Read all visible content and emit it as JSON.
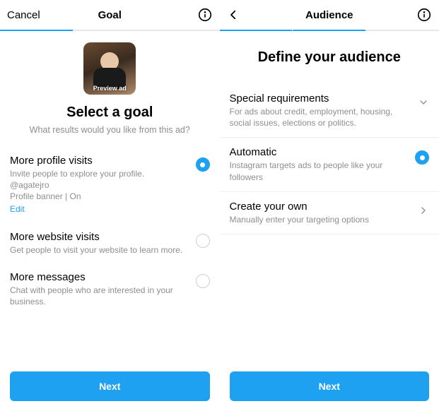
{
  "colors": {
    "accent": "#1ea1f1"
  },
  "screen1": {
    "nav": {
      "cancel": "Cancel",
      "title": "Goal"
    },
    "progress": {
      "active_step": 1,
      "total_steps": 3
    },
    "preview_label": "Preview ad",
    "title": "Select a goal",
    "subtitle": "What results would you like from this ad?",
    "options": [
      {
        "title": "More profile visits",
        "desc": "Invite people to explore your profile.",
        "meta1": "@agatejro",
        "meta2": "Profile banner | On",
        "edit": "Edit",
        "selected": true
      },
      {
        "title": "More website visits",
        "desc": "Get people to visit your website to learn more.",
        "selected": false
      },
      {
        "title": "More messages",
        "desc": "Chat with people who are interested in your business.",
        "selected": false
      }
    ],
    "next": "Next"
  },
  "screen2": {
    "nav": {
      "title": "Audience"
    },
    "progress": {
      "active_step": 2,
      "total_steps": 3
    },
    "title": "Define your audience",
    "rows": [
      {
        "title": "Special requirements",
        "desc": "For ads about credit, employment, housing, social issues, elections or politics.",
        "trailing": "chevron-down"
      },
      {
        "title": "Automatic",
        "desc": "Instagram targets ads to people like your followers",
        "trailing": "radio-selected"
      },
      {
        "title": "Create your own",
        "desc": "Manually enter your targeting options",
        "trailing": "chevron-right"
      }
    ],
    "next": "Next"
  }
}
